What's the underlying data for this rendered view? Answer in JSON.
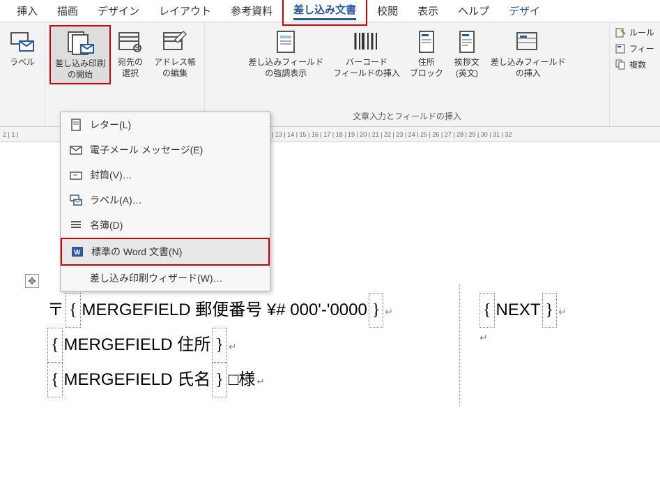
{
  "tabs": {
    "insert": "挿入",
    "draw": "描画",
    "design": "デザイン",
    "layout": "レイアウト",
    "references": "参考資料",
    "mailings": "差し込み文書",
    "review": "校閲",
    "view": "表示",
    "help": "ヘルプ",
    "tdesign": "デザイ"
  },
  "ribbon": {
    "labels_btn": "ラベル",
    "start_merge": "差し込み印刷\nの開始",
    "select_recipients": "宛先の\n選択",
    "edit_recipients": "アドレス帳\nの編集",
    "highlight_fields": "差し込みフィールド\nの強調表示",
    "barcode": "バーコード\nフィールドの挿入",
    "address_block": "住所\nブロック",
    "greeting": "挨拶文\n(英文)",
    "insert_field": "差し込みフィールド\nの挿入",
    "group2_label": "文章入力とフィールドの挿入",
    "rules": "ルール",
    "match_fields": "フィー",
    "multiple": "複数"
  },
  "dropdown": {
    "letter": "レター(L)",
    "email": "電子メール メッセージ(E)",
    "envelope": "封筒(V)…",
    "label": "ラベル(A)…",
    "directory": "名簿(D)",
    "normal_doc": "標準の Word 文書(N)",
    "wizard": "差し込み印刷ウィザード(W)…"
  },
  "ruler": {
    "left": "2 | 1 |",
    "right": "| 13 | 14 | 15 | 16 | 17 | 18 | 19 | 20 | 21 | 22 | 23 | 24 | 25 | 26 | 27 | 28 | 29 | 30 | 31 | 32"
  },
  "doc": {
    "postal_prefix": "〒",
    "mf_postal": " MERGEFIELD 郵便番号 ¥# 000'-'0000 ",
    "mf_address": " MERGEFIELD 住所 ",
    "mf_name": " MERGEFIELD 氏名 ",
    "name_suffix": "□様",
    "next_field": " NEXT "
  }
}
